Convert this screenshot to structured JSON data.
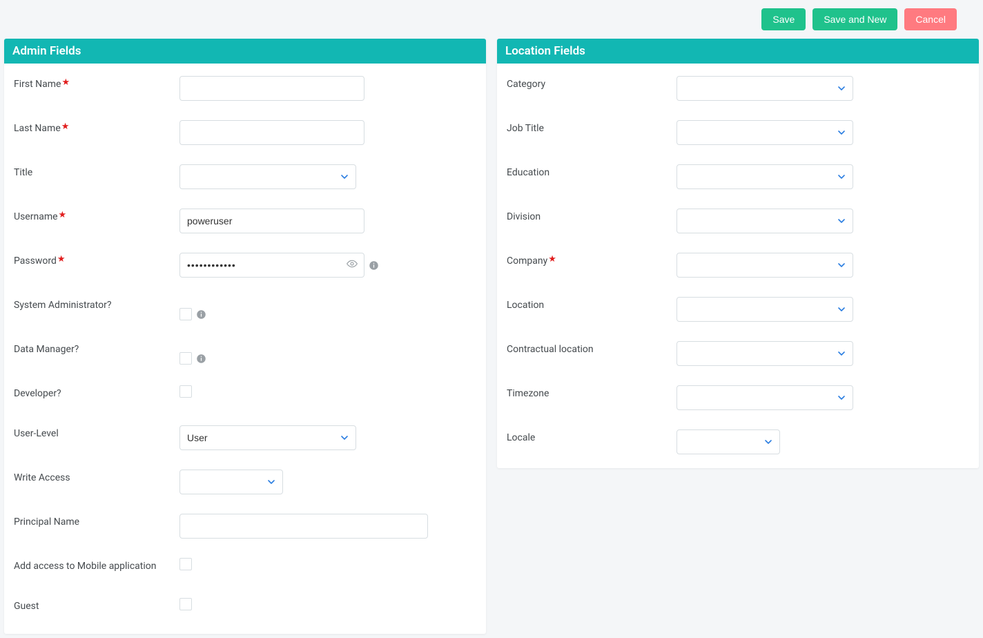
{
  "toolbar": {
    "save_label": "Save",
    "save_new_label": "Save and New",
    "cancel_label": "Cancel"
  },
  "panels": {
    "admin": {
      "title": "Admin Fields",
      "first_name": {
        "label": "First Name",
        "value": "",
        "required": true
      },
      "last_name": {
        "label": "Last Name",
        "value": "",
        "required": true
      },
      "title_f": {
        "label": "Title",
        "value": ""
      },
      "username": {
        "label": "Username",
        "value": "poweruser",
        "required": true
      },
      "password": {
        "label": "Password",
        "value": "••••••••••••",
        "required": true
      },
      "sys_admin": {
        "label": "System Administrator?"
      },
      "data_mgr": {
        "label": "Data Manager?"
      },
      "developer": {
        "label": "Developer?"
      },
      "user_level": {
        "label": "User-Level",
        "value": "User"
      },
      "write_access": {
        "label": "Write Access",
        "value": ""
      },
      "principal_name": {
        "label": "Principal Name",
        "value": ""
      },
      "mobile_access": {
        "label": "Add access to Mobile application"
      },
      "guest": {
        "label": "Guest"
      }
    },
    "location": {
      "title": "Location Fields",
      "category": {
        "label": "Category",
        "value": ""
      },
      "job_title": {
        "label": "Job Title",
        "value": ""
      },
      "education": {
        "label": "Education",
        "value": ""
      },
      "division": {
        "label": "Division",
        "value": ""
      },
      "company": {
        "label": "Company",
        "value": "",
        "required": true
      },
      "location_f": {
        "label": "Location",
        "value": ""
      },
      "contractual": {
        "label": "Contractual location",
        "value": ""
      },
      "timezone": {
        "label": "Timezone",
        "value": ""
      },
      "locale": {
        "label": "Locale",
        "value": ""
      }
    }
  }
}
